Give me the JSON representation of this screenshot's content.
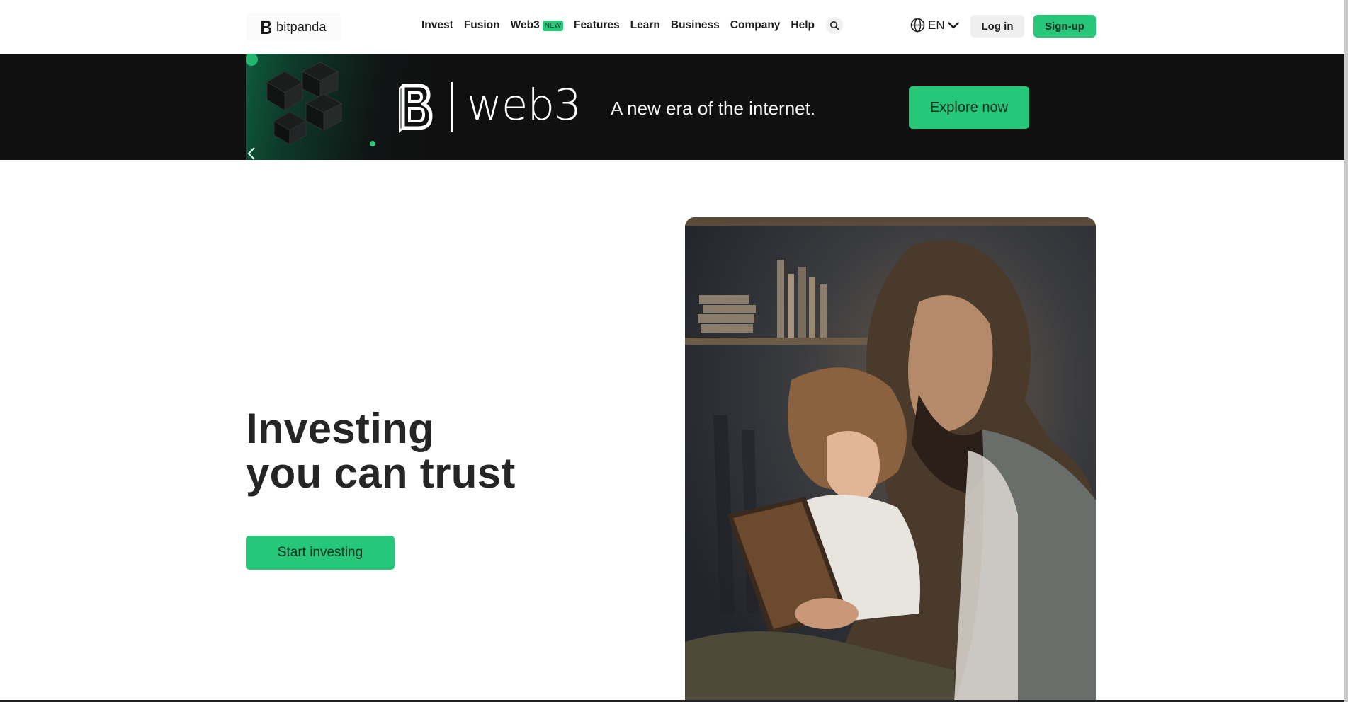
{
  "header": {
    "logo_text": "bitpanda",
    "nav": [
      {
        "label": "Invest"
      },
      {
        "label": "Fusion"
      },
      {
        "label": "Web3",
        "badge": "NEW"
      },
      {
        "label": "Features"
      },
      {
        "label": "Learn"
      },
      {
        "label": "Business"
      },
      {
        "label": "Company"
      },
      {
        "label": "Help"
      }
    ],
    "language": "EN",
    "login_label": "Log in",
    "signup_label": "Sign-up"
  },
  "banner": {
    "brand_text": "web3",
    "tagline": "A new era of the internet.",
    "cta_label": "Explore now"
  },
  "hero": {
    "title_line1": "Investing",
    "title_line2": "you can trust",
    "cta_label": "Start investing"
  },
  "colors": {
    "accent": "#27c77a",
    "banner_bg": "#101010",
    "text": "#252525"
  }
}
